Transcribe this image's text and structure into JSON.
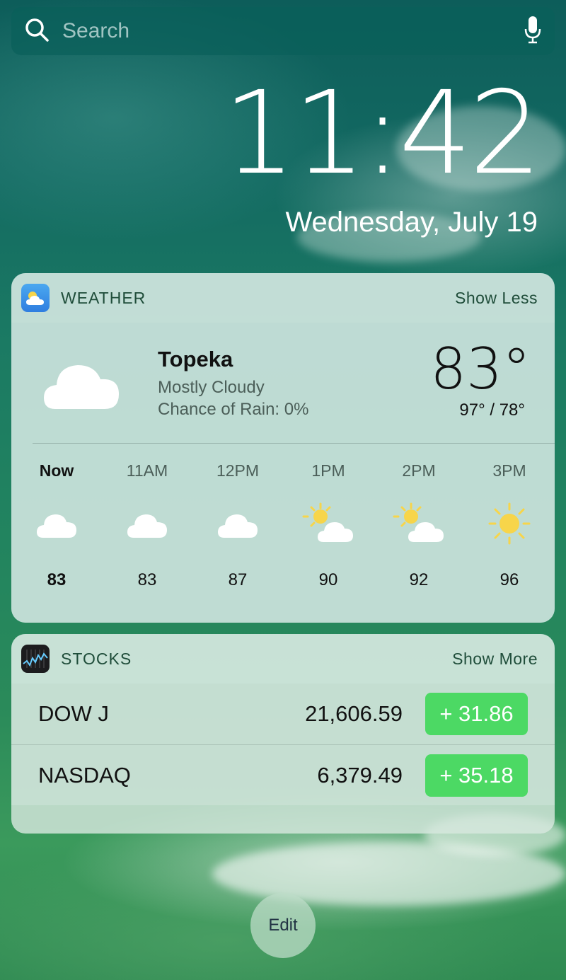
{
  "search": {
    "placeholder": "Search",
    "icons": [
      "search-icon",
      "microphone-icon"
    ]
  },
  "lock": {
    "time": "11:42",
    "date": "Wednesday, July 19"
  },
  "weather": {
    "app_title": "WEATHER",
    "toggle_label": "Show Less",
    "city": "Topeka",
    "condition": "Mostly Cloudy",
    "rain": "Chance of Rain: 0%",
    "current_temp": "83°",
    "hi_lo": "97° / 78°",
    "hourly": [
      {
        "label": "Now",
        "icon": "cloud-icon",
        "temp": "83"
      },
      {
        "label": "11AM",
        "icon": "cloud-icon",
        "temp": "83"
      },
      {
        "label": "12PM",
        "icon": "cloud-icon",
        "temp": "87"
      },
      {
        "label": "1PM",
        "icon": "partly-sunny-icon",
        "temp": "90"
      },
      {
        "label": "2PM",
        "icon": "partly-sunny-icon",
        "temp": "92"
      },
      {
        "label": "3PM",
        "icon": "sun-icon",
        "temp": "96"
      }
    ]
  },
  "stocks": {
    "app_title": "STOCKS",
    "toggle_label": "Show More",
    "rows": [
      {
        "symbol": "DOW J",
        "value": "21,606.59",
        "change": "+ 31.86"
      },
      {
        "symbol": "NASDAQ",
        "value": "6,379.49",
        "change": "+ 35.18"
      }
    ]
  },
  "edit_label": "Edit",
  "colors": {
    "positive_change": "#4cd964",
    "sun": "#f7d54a"
  }
}
